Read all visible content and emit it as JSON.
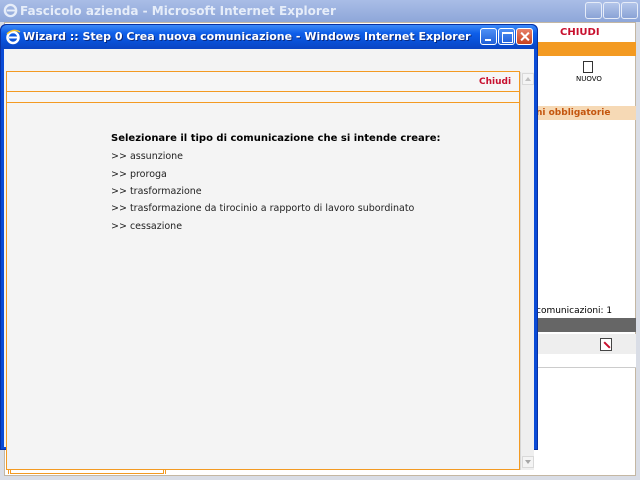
{
  "parent_window": {
    "title": "Fascicolo azienda - Microsoft Internet Explorer",
    "chiudi": "CHIUDI",
    "nuovo": "NUOVO",
    "tab_label": "ni obbligatorie",
    "count_label": "comunicazioni: 1",
    "colors": {
      "accent": "#f39a22",
      "close_red": "#c8102e"
    }
  },
  "dialog": {
    "title": "Wizard :: Step 0 Crea nuova comunicazione - Windows Internet Explorer",
    "chiudi": "Chiudi",
    "prompt": "Selezionare il tipo di comunicazione che si intende creare:",
    "options": [
      {
        "arrow": ">>",
        "label": "assunzione"
      },
      {
        "arrow": ">>",
        "label": "proroga"
      },
      {
        "arrow": ">>",
        "label": "trasformazione"
      },
      {
        "arrow": ">>",
        "label": "trasformazione da tirocinio a rapporto di lavoro subordinato"
      },
      {
        "arrow": ">>",
        "label": "cessazione"
      }
    ],
    "icons": [
      "ie-icon",
      "minimize-icon",
      "maximize-icon",
      "close-icon"
    ]
  }
}
